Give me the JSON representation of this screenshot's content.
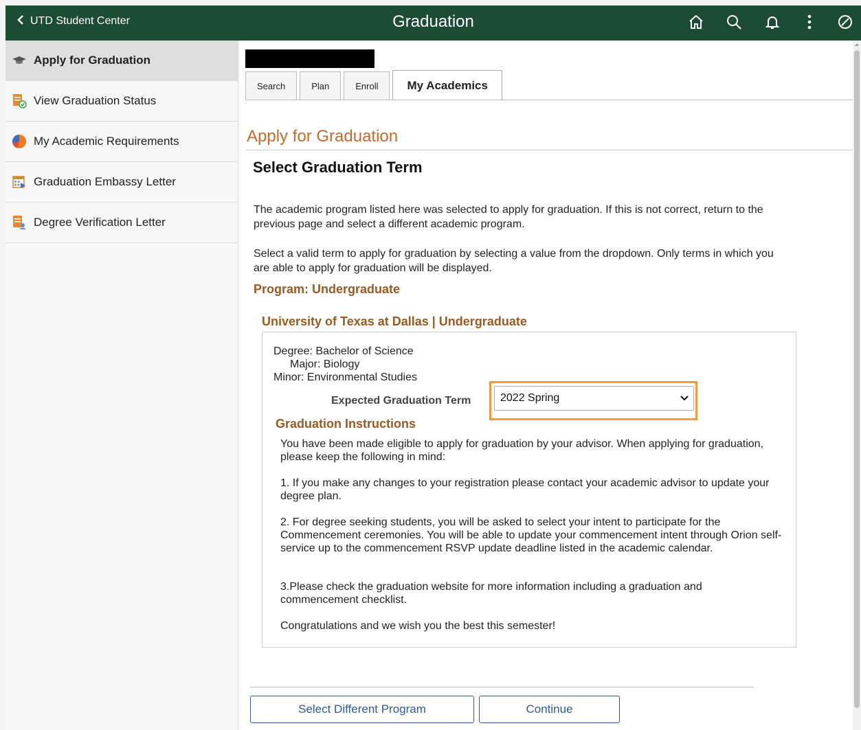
{
  "header": {
    "back_label": "UTD Student Center",
    "title": "Graduation",
    "bg_color": "#1d4c34",
    "icons": [
      "home-icon",
      "search-icon",
      "bell-icon",
      "more-vertical-icon",
      "compass-icon"
    ]
  },
  "sidebar": {
    "items": [
      {
        "label": "Apply for Graduation",
        "icon": "graduation-cap-icon",
        "active": true
      },
      {
        "label": "View Graduation Status",
        "icon": "document-check-icon"
      },
      {
        "label": "My Academic Requirements",
        "icon": "pie-chart-icon"
      },
      {
        "label": "Graduation Embassy Letter",
        "icon": "calendar-icon"
      },
      {
        "label": "Degree Verification Letter",
        "icon": "document-person-icon"
      }
    ]
  },
  "tabs": [
    "Search",
    "Plan",
    "Enroll",
    "My Academics"
  ],
  "page": {
    "title": "Apply for Graduation",
    "subtitle": "Select Graduation Term",
    "para1": "The academic program listed here was selected to apply for graduation. If this is not correct, return to the previous page and select a different academic program.",
    "para2": "Select a valid term to apply for graduation by selecting a value from the dropdown. Only terms in which you are able to apply for graduation will be displayed.",
    "program": "Program: Undergraduate",
    "institution": "University of Texas at Dallas | Undergraduate",
    "degree": "Degree: Bachelor of Science",
    "major": "Major: Biology",
    "minor": "Minor: Environmental Studies",
    "term_label": "Expected Graduation Term",
    "term_value": "2022 Spring",
    "instructions_title": "Graduation Instructions",
    "instructions": [
      "You have been made eligible to apply for graduation by your advisor. When applying for graduation, please keep the following in mind:",
      "1. If you make any changes to your registration please contact your academic advisor to update your degree plan.",
      "2. For degree seeking students, you will be asked to select your intent to participate for the Commencement ceremonies. You will be able to update your commencement intent through Orion self- service up to the commencement RSVP update deadline listed in the academic calendar.",
      "3.Please check the graduation website for more information including a graduation and commencement checklist.",
      "Congratulations and we wish you the best this semester!"
    ]
  },
  "buttons": {
    "select_program": "Select Different Program",
    "continue": "Continue"
  },
  "colors": {
    "accent_orange": "#c26b2a",
    "section_brown": "#9a5a22",
    "highlight": "#f29a3a",
    "button_blue": "#2f5a96"
  }
}
